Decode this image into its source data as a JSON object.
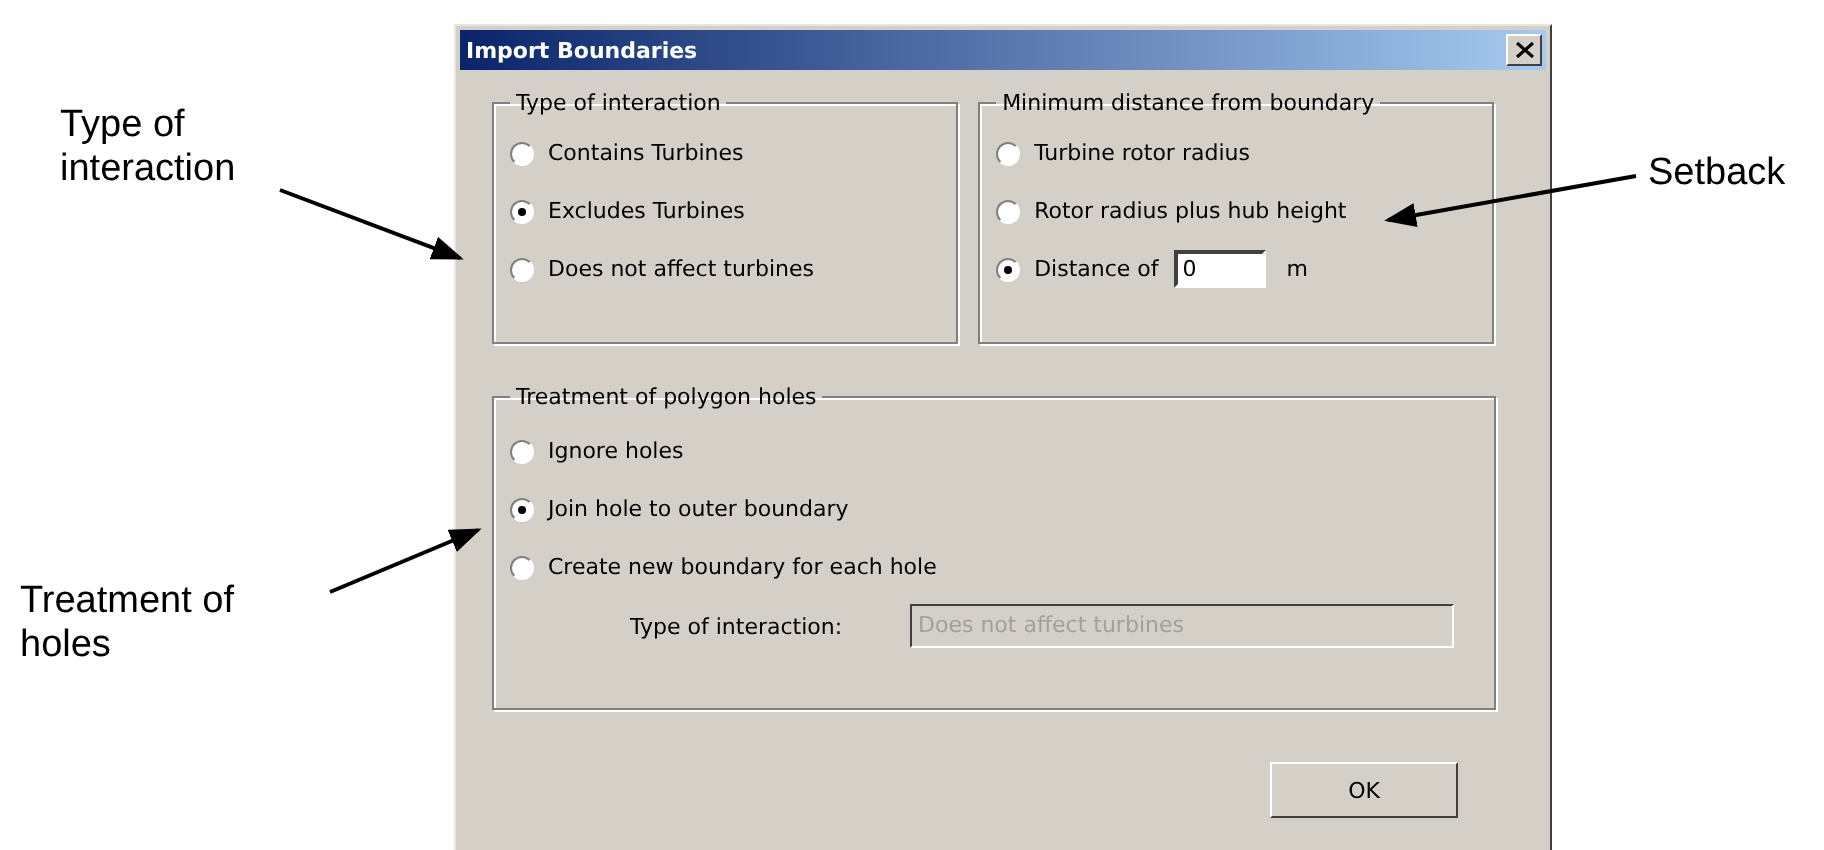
{
  "annotations": [
    {
      "lines": [
        "Type of",
        "interaction"
      ],
      "kind": "upperleft"
    },
    {
      "lines": [
        "Setback"
      ],
      "kind": "right"
    },
    {
      "lines": [
        "Treatment of",
        "holes"
      ],
      "kind": "lowerleft"
    }
  ],
  "dialog": {
    "title": "Import Boundaries",
    "groups": [
      {
        "title": "Type of interaction",
        "options": [
          {
            "kind": "plain",
            "label": "Contains Turbines",
            "selected": false
          },
          {
            "kind": "plain",
            "label": "Excludes Turbines",
            "selected": true
          },
          {
            "kind": "plain",
            "label": "Does not affect turbines",
            "selected": false
          }
        ]
      },
      {
        "title": "Minimum distance from boundary",
        "options": [
          {
            "kind": "plain",
            "label": "Turbine rotor radius",
            "selected": false
          },
          {
            "kind": "plain",
            "label": "Rotor radius plus hub height",
            "selected": false
          },
          {
            "kind": "distance",
            "label": "Distance of",
            "value": "0",
            "unit": "m",
            "selected": true
          }
        ]
      }
    ],
    "holes": {
      "title": "Treatment of polygon holes",
      "options": [
        {
          "label": "Ignore holes",
          "selected": false
        },
        {
          "label": "Join hole to outer boundary",
          "selected": true
        },
        {
          "label": "Create new boundary for each hole",
          "selected": false
        }
      ],
      "type_label": "Type of interaction:",
      "type_value": "Does not affect turbines",
      "type_disabled": true
    },
    "ok": "OK"
  }
}
